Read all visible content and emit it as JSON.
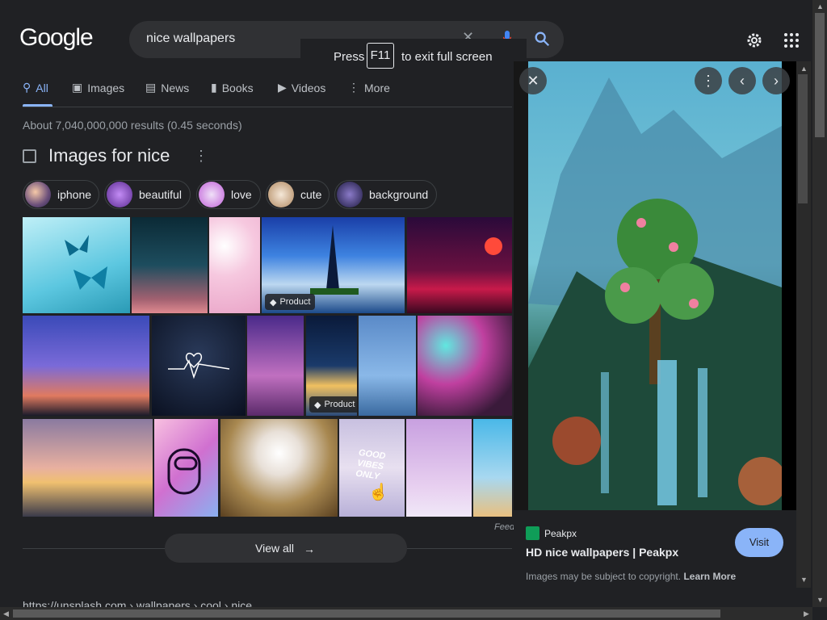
{
  "logo": "Google",
  "search": {
    "query": "nice wallpapers",
    "clear_icon": "close-icon",
    "mic_icon": "mic-icon",
    "search_icon": "search-icon"
  },
  "tooltip": {
    "press": "Press",
    "key": "F11",
    "rest": "to exit full screen"
  },
  "header": {
    "settings_icon": "gear-icon",
    "apps_icon": "apps-grid-icon"
  },
  "tabs": [
    {
      "label": "All",
      "icon": "search-icon",
      "active": true
    },
    {
      "label": "Images",
      "icon": "image-icon"
    },
    {
      "label": "News",
      "icon": "news-icon"
    },
    {
      "label": "Books",
      "icon": "book-icon"
    },
    {
      "label": "Videos",
      "icon": "video-icon"
    },
    {
      "label": "More",
      "icon": "more-vert-icon"
    }
  ],
  "stats": "About 7,040,000,000 results (0.45 seconds)",
  "images_section": {
    "title": "Images for nice",
    "chips": [
      "iphone",
      "beautiful",
      "love",
      "cute",
      "background"
    ],
    "badge_label": "Product",
    "feedback": "Feedback",
    "view_all": "View all"
  },
  "result_url": "https://unsplash.com › wallpapers › cool › nice",
  "panel": {
    "source": "Peakpx",
    "title": "HD nice wallpapers | Peakpx",
    "visit": "Visit",
    "copyright": "Images may be subject to copyright.",
    "learn_more": "Learn More"
  },
  "colors": {
    "background": "#202124",
    "accent": "#8ab4f8",
    "surface": "#303134"
  }
}
